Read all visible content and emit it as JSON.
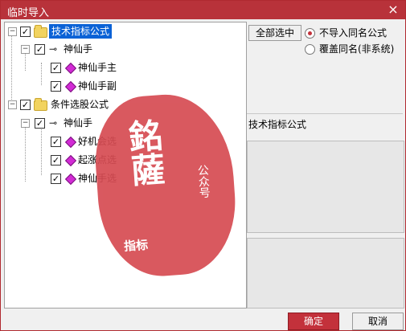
{
  "window": {
    "title": "临时导入",
    "close_icon": "×"
  },
  "tree": {
    "nodes": [
      {
        "label": "技术指标公式",
        "selected": true
      },
      {
        "label": "神仙手"
      },
      {
        "label": "神仙手主"
      },
      {
        "label": "神仙手副"
      },
      {
        "label": "条件选股公式"
      },
      {
        "label": "神仙手"
      },
      {
        "label": "好机会选"
      },
      {
        "label": "起涨点选"
      },
      {
        "label": "神仙手选"
      }
    ]
  },
  "right": {
    "select_all": "全部选中",
    "radio1": "不导入同名公式",
    "radio2": "覆盖同名(非系统)",
    "section_title": "技术指标公式"
  },
  "footer": {
    "ok": "确定",
    "cancel": "取消"
  },
  "watermark": {
    "big": "銘薩",
    "small": "公众号",
    "bottom": "指标"
  }
}
